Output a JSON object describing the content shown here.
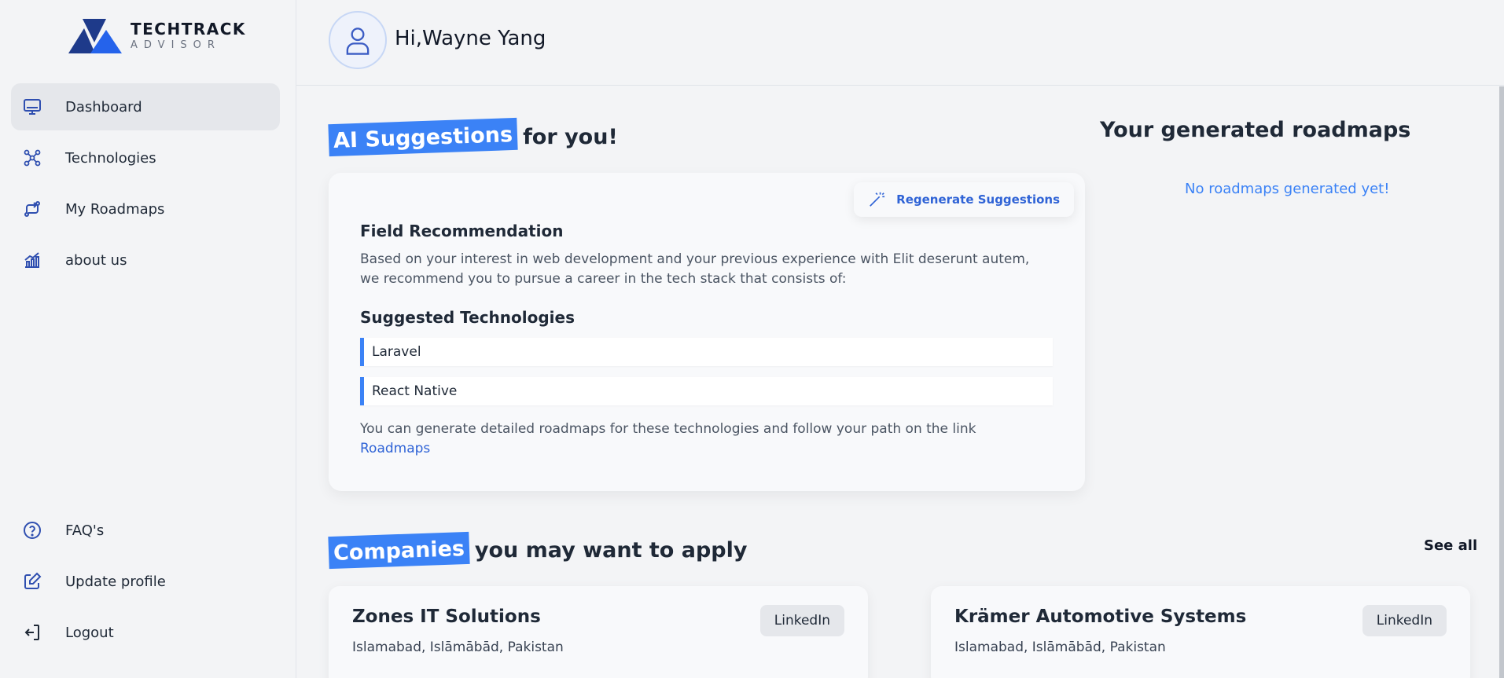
{
  "brand": {
    "title": "TECHTRACK",
    "subtitle": "ADVISOR"
  },
  "sidebar": {
    "top_items": [
      {
        "label": "Dashboard",
        "icon": "monitor-icon",
        "active": true
      },
      {
        "label": "Technologies",
        "icon": "network-icon"
      },
      {
        "label": "My Roadmaps",
        "icon": "route-icon"
      },
      {
        "label": "about us",
        "icon": "growth-chart-icon"
      }
    ],
    "bottom_items": [
      {
        "label": "FAQ's",
        "icon": "question-icon"
      },
      {
        "label": "Update profile",
        "icon": "edit-icon"
      },
      {
        "label": "Logout",
        "icon": "logout-icon"
      }
    ]
  },
  "header": {
    "greeting": "Hi,Wayne Yang"
  },
  "suggestions": {
    "title_highlight": "AI Suggestions",
    "title_rest": "for you!",
    "regenerate_label": "Regenerate Suggestions",
    "field_heading": "Field Recommendation",
    "field_text": "Based on your interest in web development and your previous experience with Elit deserunt autem, we recommend you to pursue a career in the tech stack that consists of:",
    "tech_heading": "Suggested Technologies",
    "technologies": [
      "Laravel",
      "React Native"
    ],
    "footer_text": "You can generate detailed roadmaps for these technologies and follow your path on the link",
    "footer_link": "Roadmaps"
  },
  "roadmaps": {
    "heading": "Your generated roadmaps",
    "empty_text": "No roadmaps generated yet!"
  },
  "companies": {
    "title_highlight": "Companies",
    "title_rest": "you may want to apply",
    "see_all": "See all",
    "items": [
      {
        "name": "Zones IT Solutions",
        "location": "Islamabad, Islāmābād, Pakistan",
        "button": "LinkedIn"
      },
      {
        "name": "Krämer Automotive Systems",
        "location": "Islamabad, Islāmābād, Pakistan",
        "button": "LinkedIn"
      }
    ]
  },
  "colors": {
    "accent": "#3b82f6",
    "link": "#2f63d6",
    "active_nav": "#e5e7eb"
  }
}
